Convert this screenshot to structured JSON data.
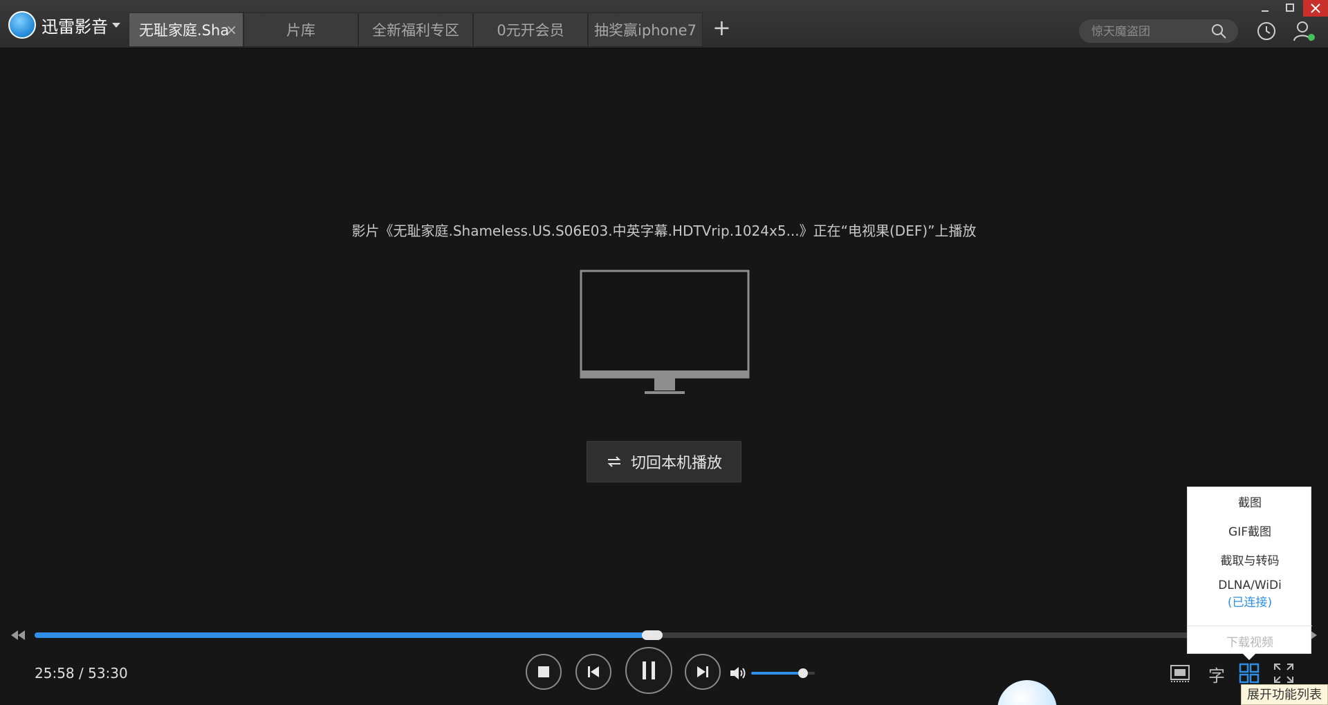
{
  "app": {
    "name": "迅雷影音"
  },
  "tabs": [
    {
      "label": "无耻家庭.Sha",
      "active": true
    },
    {
      "label": "片库"
    },
    {
      "label": "全新福利专区"
    },
    {
      "label": "0元开会员"
    },
    {
      "label": "抽奖赢iphone7"
    }
  ],
  "toolbar": {
    "add_tab_label": "+",
    "search_placeholder": "惊天魔盗团"
  },
  "cast": {
    "message": "影片《无耻家庭.Shameless.US.S06E03.中英字幕.HDTVrip.1024x5...》正在“电视果(DEF)”上播放",
    "switch_button_label": "切回本机播放"
  },
  "player": {
    "current_time": "25:58",
    "duration": "53:30",
    "time_display": "25:58 / 53:30",
    "progress_fraction": 0.4854,
    "volume_fraction": 0.82,
    "subtitle_button_label": "字"
  },
  "menu": {
    "items": [
      "截图",
      "GIF截图",
      "截取与转码",
      "DLNA/WiDi"
    ],
    "dlna_status": "(已连接)",
    "download_label": "下载视频"
  },
  "tooltip": {
    "text": "展开功能列表"
  },
  "colors": {
    "accent": "#2f8fe6",
    "background": "#161616",
    "titlebar": "#2c2c2c",
    "close": "#c9302c"
  }
}
